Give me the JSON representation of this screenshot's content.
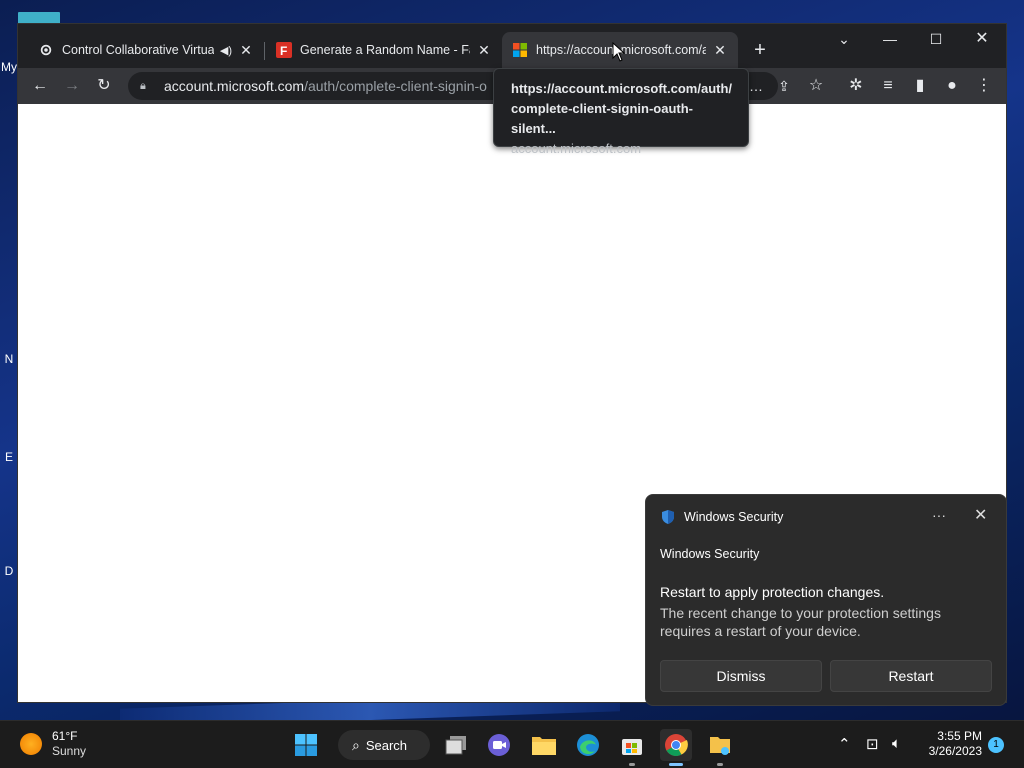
{
  "desktop": {
    "fragments": [
      "My",
      "N",
      "E",
      "D"
    ]
  },
  "browser": {
    "tabs": [
      {
        "title": "Control Collaborative Virtual",
        "favicon": "settings-icon",
        "audio": true
      },
      {
        "title": "Generate a Random Name - Fake",
        "favicon": "fakename-f-icon",
        "audio": false
      },
      {
        "title": "https://account.microsoft.com/auth/",
        "favicon": "microsoft-icon",
        "audio": false,
        "active": true
      }
    ],
    "url_host": "account.microsoft.com",
    "url_path": "/auth/complete-client-signin-o",
    "tooltip": {
      "title": "https://account.microsoft.com/auth/ complete-client-signin-oauth-silent...",
      "domain": "account.microsoft.com"
    }
  },
  "notification": {
    "header": "Windows Security",
    "app": "Windows Security",
    "title": "Restart to apply protection changes.",
    "body": "The recent change to your protection settings requires a restart of your device.",
    "dismiss_label": "Dismiss",
    "restart_label": "Restart",
    "more": "···",
    "close": "✕"
  },
  "taskbar": {
    "weather_temp": "61°F",
    "weather_cond": "Sunny",
    "search_label": "Search",
    "time": "3:55 PM",
    "date": "3/26/2023",
    "badge": "1"
  },
  "colors": {
    "accent": "#4cc2ff",
    "tab_strip": "#202124",
    "toolbar": "#35363a"
  }
}
